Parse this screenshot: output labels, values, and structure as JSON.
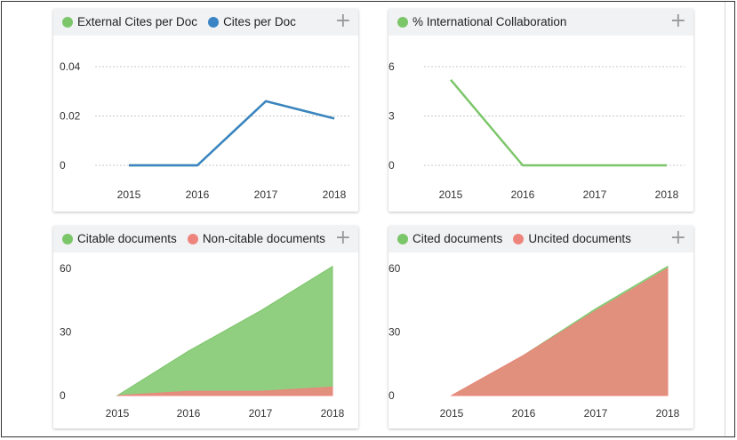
{
  "colors": {
    "green": "#7cc66a",
    "blue": "#3b84c4",
    "red": "#ee857d"
  },
  "charts": [
    {
      "legend": [
        {
          "label": "External Cites per Doc",
          "color": "#7cc66a"
        },
        {
          "label": "Cites per Doc",
          "color": "#3b84c4"
        }
      ],
      "plus": "+"
    },
    {
      "legend": [
        {
          "label": "% International Collaboration",
          "color": "#7cc66a"
        }
      ],
      "plus": "+"
    },
    {
      "legend": [
        {
          "label": "Citable documents",
          "color": "#7cc66a"
        },
        {
          "label": "Non-citable documents",
          "color": "#ee857d"
        }
      ],
      "plus": "+"
    },
    {
      "legend": [
        {
          "label": "Cited documents",
          "color": "#7cc66a"
        },
        {
          "label": "Uncited documents",
          "color": "#ee857d"
        }
      ],
      "plus": "+"
    }
  ],
  "chart_data": [
    {
      "type": "line",
      "x": [
        "2015",
        "2016",
        "2017",
        "2018"
      ],
      "yticks": [
        "0",
        "0.02",
        "0.04"
      ],
      "ylim": [
        0,
        0.04
      ],
      "grid": true,
      "series": [
        {
          "name": "External Cites per Doc",
          "color": "#7cc66a",
          "values": [
            0,
            0,
            0.026,
            0.019
          ]
        },
        {
          "name": "Cites per Doc",
          "color": "#3b84c4",
          "values": [
            0,
            0,
            0.026,
            0.019
          ]
        }
      ]
    },
    {
      "type": "line",
      "x": [
        "2015",
        "2016",
        "2017",
        "2018"
      ],
      "yticks": [
        "0",
        "3",
        "6"
      ],
      "ylim": [
        0,
        6
      ],
      "grid": true,
      "series": [
        {
          "name": "% International Collaboration",
          "color": "#7cc66a",
          "values": [
            5.2,
            0,
            0,
            0
          ]
        }
      ]
    },
    {
      "type": "area",
      "x": [
        "2015",
        "2016",
        "2017",
        "2018"
      ],
      "yticks": [
        "0",
        "30",
        "60"
      ],
      "ylim": [
        0,
        60
      ],
      "grid": false,
      "series": [
        {
          "name": "Citable documents",
          "color": "#7cc66a",
          "values": [
            0,
            19,
            38,
            57
          ]
        },
        {
          "name": "Non-citable documents",
          "color": "#ee857d",
          "values": [
            0,
            2,
            2,
            4
          ]
        }
      ]
    },
    {
      "type": "area",
      "x": [
        "2015",
        "2016",
        "2017",
        "2018"
      ],
      "yticks": [
        "0",
        "30",
        "60"
      ],
      "ylim": [
        0,
        60
      ],
      "grid": false,
      "series": [
        {
          "name": "Cited documents",
          "color": "#7cc66a",
          "values": [
            0,
            0,
            1,
            1
          ]
        },
        {
          "name": "Uncited documents",
          "color": "#ee857d",
          "values": [
            0,
            19,
            40,
            60
          ]
        }
      ]
    }
  ]
}
